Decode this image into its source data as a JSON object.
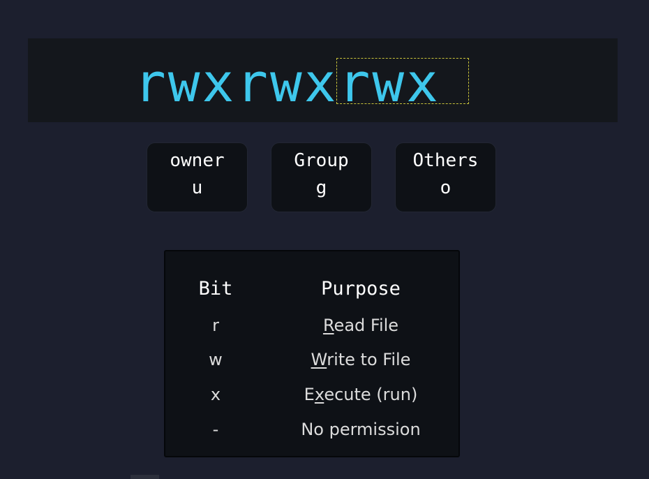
{
  "permission_string": {
    "color": "#3ec7ec",
    "groups": [
      {
        "text": "rwx",
        "scope": "owner"
      },
      {
        "text": "rwx",
        "scope": "group"
      },
      {
        "text": "rwx",
        "scope": "others",
        "highlighted": true
      }
    ]
  },
  "roles": [
    {
      "name": "owner",
      "letter": "u"
    },
    {
      "name": "Group",
      "letter": "g"
    },
    {
      "name": "Others",
      "letter": "o"
    }
  ],
  "legend": {
    "header_bit": "Bit",
    "header_purpose": "Purpose",
    "rows": [
      {
        "bit": "r",
        "purpose": {
          "pre": "",
          "key": "R",
          "post": "ead File"
        }
      },
      {
        "bit": "w",
        "purpose": {
          "pre": "",
          "key": "W",
          "post": "rite to File"
        }
      },
      {
        "bit": "x",
        "purpose": {
          "pre": "E",
          "key": "x",
          "post": "ecute (run)"
        }
      },
      {
        "bit": "-",
        "purpose": {
          "pre": "No permission",
          "key": "",
          "post": ""
        }
      }
    ]
  }
}
